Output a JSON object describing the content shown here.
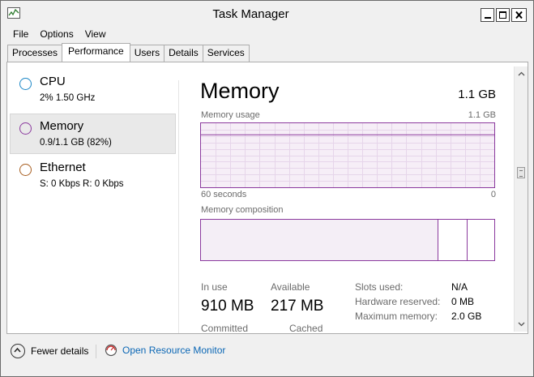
{
  "window": {
    "title": "Task Manager"
  },
  "icons": {
    "app": "task-manager-icon",
    "minimize": "minimize-icon",
    "maximize": "maximize-icon",
    "close": "close-icon",
    "fewer_details": "chevron-up-circle-icon",
    "resource_monitor": "resource-monitor-icon",
    "scroll_up": "arrow-up-icon",
    "scroll_down": "arrow-down-icon"
  },
  "menu": {
    "items": [
      "File",
      "Options",
      "View"
    ]
  },
  "tabs": [
    "Processes",
    "Performance",
    "Users",
    "Details",
    "Services"
  ],
  "active_tab": "Performance",
  "sidebar": {
    "items": [
      {
        "title": "CPU",
        "subtitle": "2%  1.50 GHz",
        "color": "#1a86c6"
      },
      {
        "title": "Memory",
        "subtitle": "0.9/1.1 GB (82%)",
        "color": "#8b3a9e",
        "selected": true
      },
      {
        "title": "Ethernet",
        "subtitle": "S: 0 Kbps  R: 0 Kbps",
        "color": "#a75d1f"
      }
    ]
  },
  "memory": {
    "title": "Memory",
    "total": "1.1 GB",
    "usage_label": "Memory usage",
    "usage_max": "1.1 GB",
    "time_span": "60 seconds",
    "time_end": "0",
    "usage_fraction": 0.82,
    "composition_label": "Memory composition",
    "composition": {
      "in_use_fraction": 0.81,
      "modified_fraction": 0.1,
      "standby_fraction": 0.09
    },
    "stats": {
      "in_use_label": "In use",
      "in_use_value": "910 MB",
      "available_label": "Available",
      "available_value": "217 MB",
      "committed_label": "Committed",
      "cached_label": "Cached"
    },
    "details": [
      {
        "label": "Slots used:",
        "value": "N/A"
      },
      {
        "label": "Hardware reserved:",
        "value": "0 MB"
      },
      {
        "label": "Maximum memory:",
        "value": "2.0 GB"
      }
    ]
  },
  "footer": {
    "fewer_details": "Fewer details",
    "open_resource_monitor": "Open Resource Monitor"
  },
  "colors": {
    "accent": "#8b3a9e",
    "graph_fill": "#f6eef7",
    "link": "#0b67b5"
  }
}
